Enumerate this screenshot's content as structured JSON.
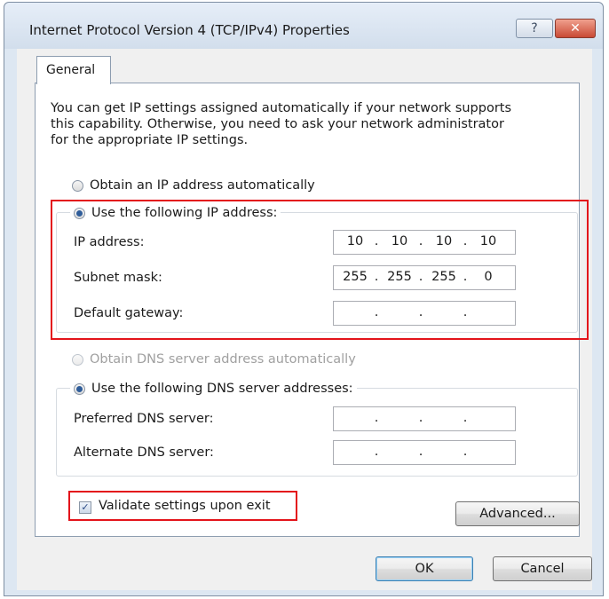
{
  "window": {
    "title": "Internet Protocol Version 4 (TCP/IPv4) Properties",
    "help_glyph": "?",
    "close_glyph": "✕"
  },
  "tabs": [
    {
      "label": "General",
      "active": true
    }
  ],
  "info_text": {
    "line1": "You can get IP settings assigned automatically if your network supports",
    "line2": "this capability. Otherwise, you need to ask your network administrator",
    "line3": "for the appropriate IP settings."
  },
  "ip_mode": {
    "auto_label": "Obtain an IP address automatically",
    "manual_label": "Use the following IP address:",
    "selected": "manual"
  },
  "ip_fields": {
    "ip_address": {
      "label": "IP address:",
      "octets": [
        "10",
        "10",
        "10",
        "10"
      ]
    },
    "subnet_mask": {
      "label": "Subnet mask:",
      "octets": [
        "255",
        "255",
        "255",
        "0"
      ]
    },
    "default_gateway": {
      "label": "Default gateway:",
      "octets": [
        "",
        "",
        "",
        ""
      ]
    }
  },
  "dns_mode": {
    "auto_label": "Obtain DNS server address automatically",
    "auto_enabled": false,
    "manual_label": "Use the following DNS server addresses:",
    "selected": "manual"
  },
  "dns_fields": {
    "preferred": {
      "label": "Preferred DNS server:",
      "octets": [
        "",
        "",
        "",
        ""
      ]
    },
    "alternate": {
      "label": "Alternate DNS server:",
      "octets": [
        "",
        "",
        "",
        ""
      ]
    }
  },
  "validate": {
    "label": "Validate settings upon exit",
    "checked": true,
    "check_glyph": "✓"
  },
  "buttons": {
    "advanced": "Advanced...",
    "ok": "OK",
    "cancel": "Cancel"
  },
  "colors": {
    "highlight_frame": "#e3141b",
    "radio_dot": "#2f5d9a"
  }
}
